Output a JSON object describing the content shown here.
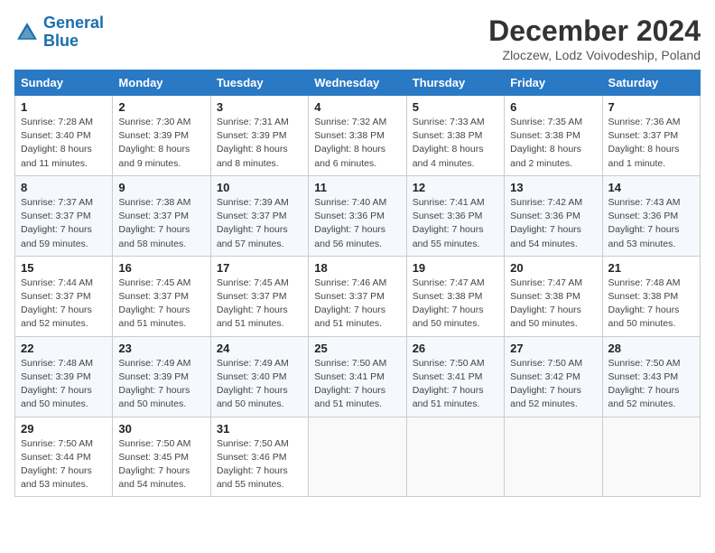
{
  "header": {
    "logo_line1": "General",
    "logo_line2": "Blue",
    "title": "December 2024",
    "subtitle": "Zloczew, Lodz Voivodeship, Poland"
  },
  "weekdays": [
    "Sunday",
    "Monday",
    "Tuesday",
    "Wednesday",
    "Thursday",
    "Friday",
    "Saturday"
  ],
  "weeks": [
    [
      {
        "day": "1",
        "info": "Sunrise: 7:28 AM\nSunset: 3:40 PM\nDaylight: 8 hours and 11 minutes."
      },
      {
        "day": "2",
        "info": "Sunrise: 7:30 AM\nSunset: 3:39 PM\nDaylight: 8 hours and 9 minutes."
      },
      {
        "day": "3",
        "info": "Sunrise: 7:31 AM\nSunset: 3:39 PM\nDaylight: 8 hours and 8 minutes."
      },
      {
        "day": "4",
        "info": "Sunrise: 7:32 AM\nSunset: 3:38 PM\nDaylight: 8 hours and 6 minutes."
      },
      {
        "day": "5",
        "info": "Sunrise: 7:33 AM\nSunset: 3:38 PM\nDaylight: 8 hours and 4 minutes."
      },
      {
        "day": "6",
        "info": "Sunrise: 7:35 AM\nSunset: 3:38 PM\nDaylight: 8 hours and 2 minutes."
      },
      {
        "day": "7",
        "info": "Sunrise: 7:36 AM\nSunset: 3:37 PM\nDaylight: 8 hours and 1 minute."
      }
    ],
    [
      {
        "day": "8",
        "info": "Sunrise: 7:37 AM\nSunset: 3:37 PM\nDaylight: 7 hours and 59 minutes."
      },
      {
        "day": "9",
        "info": "Sunrise: 7:38 AM\nSunset: 3:37 PM\nDaylight: 7 hours and 58 minutes."
      },
      {
        "day": "10",
        "info": "Sunrise: 7:39 AM\nSunset: 3:37 PM\nDaylight: 7 hours and 57 minutes."
      },
      {
        "day": "11",
        "info": "Sunrise: 7:40 AM\nSunset: 3:36 PM\nDaylight: 7 hours and 56 minutes."
      },
      {
        "day": "12",
        "info": "Sunrise: 7:41 AM\nSunset: 3:36 PM\nDaylight: 7 hours and 55 minutes."
      },
      {
        "day": "13",
        "info": "Sunrise: 7:42 AM\nSunset: 3:36 PM\nDaylight: 7 hours and 54 minutes."
      },
      {
        "day": "14",
        "info": "Sunrise: 7:43 AM\nSunset: 3:36 PM\nDaylight: 7 hours and 53 minutes."
      }
    ],
    [
      {
        "day": "15",
        "info": "Sunrise: 7:44 AM\nSunset: 3:37 PM\nDaylight: 7 hours and 52 minutes."
      },
      {
        "day": "16",
        "info": "Sunrise: 7:45 AM\nSunset: 3:37 PM\nDaylight: 7 hours and 51 minutes."
      },
      {
        "day": "17",
        "info": "Sunrise: 7:45 AM\nSunset: 3:37 PM\nDaylight: 7 hours and 51 minutes."
      },
      {
        "day": "18",
        "info": "Sunrise: 7:46 AM\nSunset: 3:37 PM\nDaylight: 7 hours and 51 minutes."
      },
      {
        "day": "19",
        "info": "Sunrise: 7:47 AM\nSunset: 3:38 PM\nDaylight: 7 hours and 50 minutes."
      },
      {
        "day": "20",
        "info": "Sunrise: 7:47 AM\nSunset: 3:38 PM\nDaylight: 7 hours and 50 minutes."
      },
      {
        "day": "21",
        "info": "Sunrise: 7:48 AM\nSunset: 3:38 PM\nDaylight: 7 hours and 50 minutes."
      }
    ],
    [
      {
        "day": "22",
        "info": "Sunrise: 7:48 AM\nSunset: 3:39 PM\nDaylight: 7 hours and 50 minutes."
      },
      {
        "day": "23",
        "info": "Sunrise: 7:49 AM\nSunset: 3:39 PM\nDaylight: 7 hours and 50 minutes."
      },
      {
        "day": "24",
        "info": "Sunrise: 7:49 AM\nSunset: 3:40 PM\nDaylight: 7 hours and 50 minutes."
      },
      {
        "day": "25",
        "info": "Sunrise: 7:50 AM\nSunset: 3:41 PM\nDaylight: 7 hours and 51 minutes."
      },
      {
        "day": "26",
        "info": "Sunrise: 7:50 AM\nSunset: 3:41 PM\nDaylight: 7 hours and 51 minutes."
      },
      {
        "day": "27",
        "info": "Sunrise: 7:50 AM\nSunset: 3:42 PM\nDaylight: 7 hours and 52 minutes."
      },
      {
        "day": "28",
        "info": "Sunrise: 7:50 AM\nSunset: 3:43 PM\nDaylight: 7 hours and 52 minutes."
      }
    ],
    [
      {
        "day": "29",
        "info": "Sunrise: 7:50 AM\nSunset: 3:44 PM\nDaylight: 7 hours and 53 minutes."
      },
      {
        "day": "30",
        "info": "Sunrise: 7:50 AM\nSunset: 3:45 PM\nDaylight: 7 hours and 54 minutes."
      },
      {
        "day": "31",
        "info": "Sunrise: 7:50 AM\nSunset: 3:46 PM\nDaylight: 7 hours and 55 minutes."
      },
      null,
      null,
      null,
      null
    ]
  ]
}
